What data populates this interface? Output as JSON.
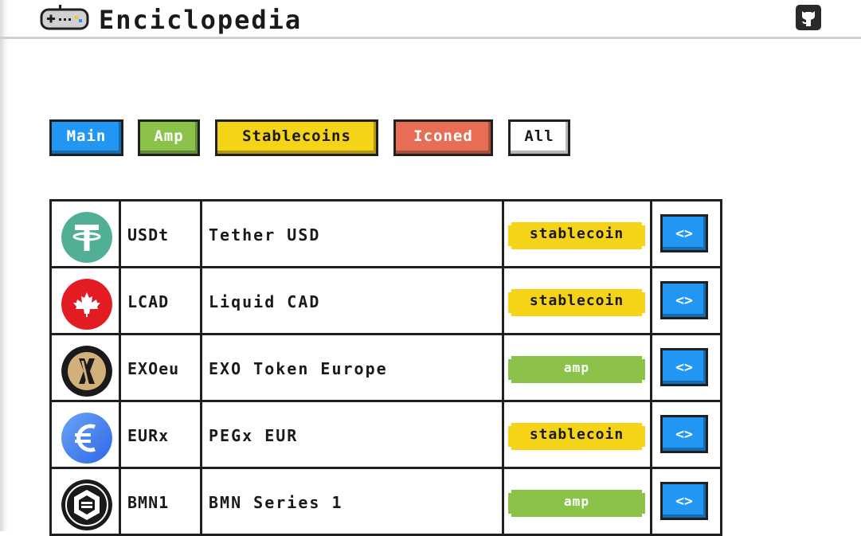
{
  "header": {
    "title": "Enciclopedia",
    "logo_icon": "gamepad-icon",
    "github_icon": "github-icon"
  },
  "filters": [
    {
      "label": "Main",
      "color": "#2196f3",
      "text_color": "#ffffff"
    },
    {
      "label": "Amp",
      "color": "#8bc34a",
      "text_color": "#ffffff"
    },
    {
      "label": "Stablecoins",
      "color": "#f5d317",
      "text_color": "#1a1a1a"
    },
    {
      "label": "Iconed",
      "color": "#e76e55",
      "text_color": "#ffffff"
    },
    {
      "label": "All",
      "color": "#ffffff",
      "text_color": "#1a1a1a"
    }
  ],
  "assets": [
    {
      "ticker": "USDt",
      "name": "Tether USD",
      "tag": "stablecoin",
      "icon": "tether-icon",
      "icon_color": "#50af95"
    },
    {
      "ticker": "LCAD",
      "name": "Liquid CAD",
      "tag": "stablecoin",
      "icon": "maple-leaf-icon",
      "icon_color": "#e31b23"
    },
    {
      "ticker": "EXOeu",
      "name": "EXO Token Europe",
      "tag": "amp",
      "icon": "exo-icon",
      "icon_color": "#1a1a1a"
    },
    {
      "ticker": "EURx",
      "name": "PEGx EUR",
      "tag": "stablecoin",
      "icon": "euro-icon",
      "icon_color": "#3d7ff0"
    },
    {
      "ticker": "BMN1",
      "name": "BMN Series 1",
      "tag": "amp",
      "icon": "bmn-icon",
      "icon_color": "#1a1a1a"
    }
  ],
  "action_label": "<>"
}
